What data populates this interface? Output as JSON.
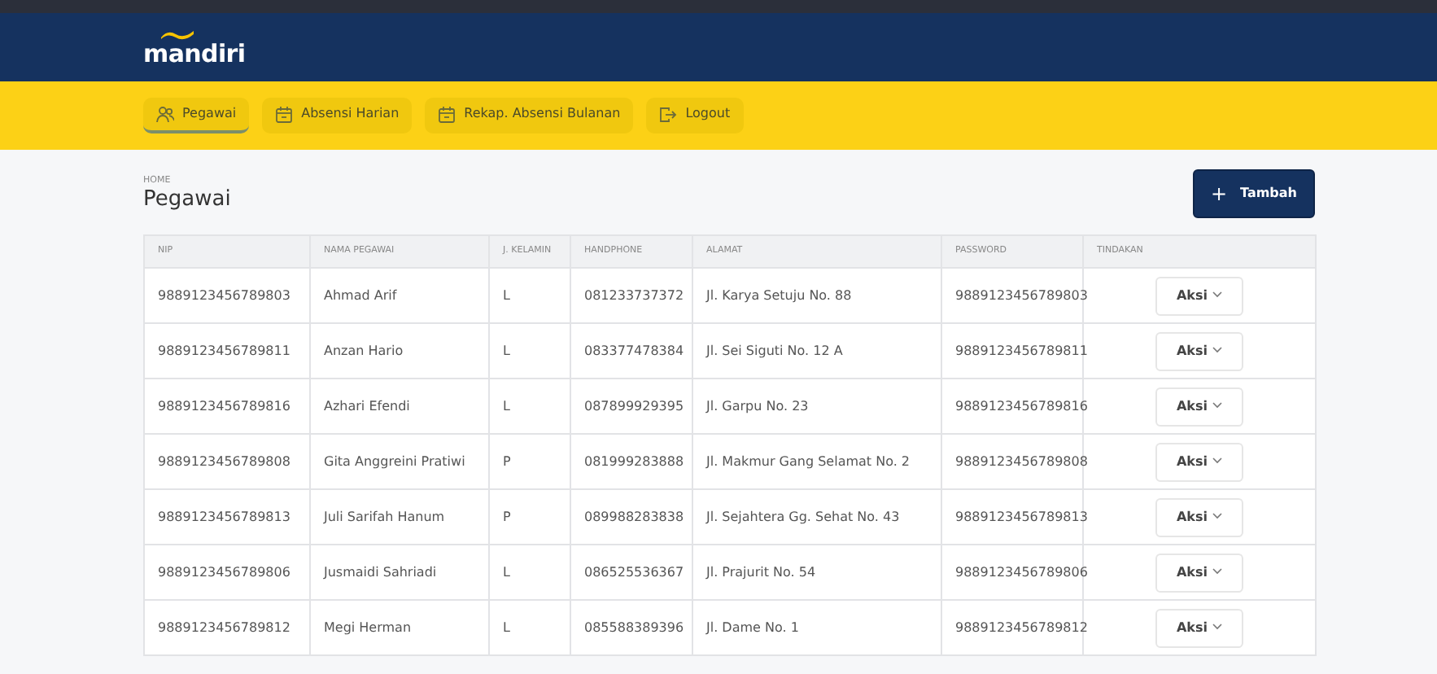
{
  "brand": {
    "logo_text": "mandiri"
  },
  "nav": [
    {
      "label": "Pegawai",
      "kind": "people",
      "selected": true
    },
    {
      "label": "Absensi Harian",
      "kind": "calendar",
      "selected": false
    },
    {
      "label": "Rekap. Absensi Bulanan",
      "kind": "calendar",
      "selected": false
    },
    {
      "label": "Logout",
      "kind": "logout",
      "selected": false
    }
  ],
  "breadcrumb": "HOME",
  "page_title": "Pegawai",
  "add_button": {
    "icon": "+",
    "label": "Tambah"
  },
  "table": {
    "columns": [
      "NIP",
      "NAMA PEGAWAI",
      "J. KELAMIN",
      "HANDPHONE",
      "ALAMAT",
      "PASSWORD",
      "TINDAKAN"
    ],
    "rows": [
      {
        "cells": [
          "9889123456789803",
          "Ahmad Arif",
          "L",
          "081233737372",
          "Jl. Karya Setuju No. 88",
          "9889123456789803"
        ],
        "action": "Aksi"
      },
      {
        "cells": [
          "9889123456789811",
          "Anzan Hario",
          "L",
          "083377478384",
          "Jl. Sei Siguti No. 12 A",
          "9889123456789811"
        ],
        "action": "Aksi"
      },
      {
        "cells": [
          "9889123456789816",
          "Azhari Efendi",
          "L",
          "087899929395",
          "Jl. Garpu No. 23",
          "9889123456789816"
        ],
        "action": "Aksi"
      },
      {
        "cells": [
          "9889123456789808",
          "Gita Anggreini Pratiwi",
          "P",
          "081999283888",
          "Jl. Makmur Gang Selamat No. 2",
          "9889123456789808"
        ],
        "action": "Aksi"
      },
      {
        "cells": [
          "9889123456789813",
          "Juli Sarifah Hanum",
          "P",
          "089988283838",
          "Jl. Sejahtera Gg. Sehat No. 43",
          "9889123456789813"
        ],
        "action": "Aksi"
      },
      {
        "cells": [
          "9889123456789806",
          "Jusmaidi Sahriadi",
          "L",
          "086525536367",
          "Jl. Prajurit No. 54",
          "9889123456789806"
        ],
        "action": "Aksi"
      },
      {
        "cells": [
          "9889123456789812",
          "Megi Herman",
          "L",
          "085588389396",
          "Jl. Dame No. 1",
          "9889123456789812"
        ],
        "action": "Aksi"
      }
    ]
  }
}
